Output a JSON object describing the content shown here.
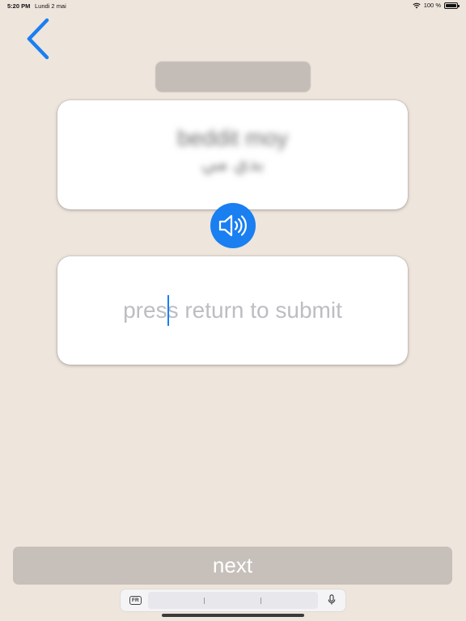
{
  "status_bar": {
    "time": "5:20 PM",
    "date": "Lundi 2 mai",
    "battery": "100 %"
  },
  "prompt": {
    "line1": "beddit moy",
    "line2": "بدي مي"
  },
  "answer": {
    "placeholder": "press return to submit",
    "value": ""
  },
  "next_label": "next",
  "keyboard": {
    "language": "FR"
  },
  "icons": {
    "back": "chevron-left-icon",
    "speaker": "speaker-wave-icon",
    "wifi": "wifi-icon",
    "battery": "battery-icon",
    "mic": "microphone-icon"
  },
  "colors": {
    "accent": "#1A7FF0",
    "background": "#EEE5DD",
    "button_disabled": "#C7C0BA"
  }
}
